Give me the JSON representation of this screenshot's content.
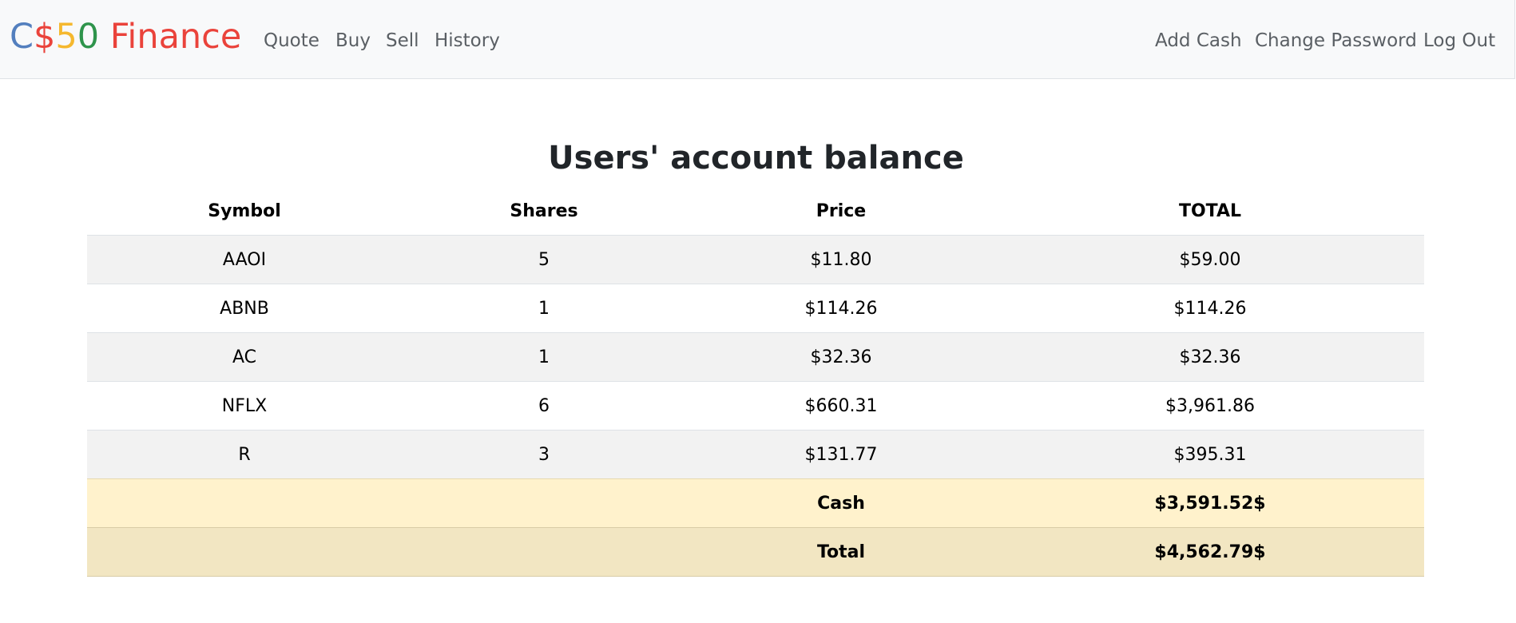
{
  "brand": {
    "parts": [
      {
        "text": "C",
        "color": "#537fbe"
      },
      {
        "text": "$",
        "color": "#ea433b"
      },
      {
        "text": "5",
        "color": "#f5b82e"
      },
      {
        "text": "0",
        "color": "#2e944b"
      },
      {
        "text": " Finance",
        "color": "#ea433b"
      }
    ]
  },
  "nav": {
    "left": [
      "Quote",
      "Buy",
      "Sell",
      "History"
    ],
    "right": [
      "Add Cash",
      "Change Password",
      "Log Out"
    ]
  },
  "main": {
    "title": "Users' account balance",
    "headers": [
      "Symbol",
      "Shares",
      "Price",
      "TOTAL"
    ],
    "rows": [
      {
        "symbol": "AAOI",
        "shares": "5",
        "price": "$11.80",
        "total": "$59.00"
      },
      {
        "symbol": "ABNB",
        "shares": "1",
        "price": "$114.26",
        "total": "$114.26"
      },
      {
        "symbol": "AC",
        "shares": "1",
        "price": "$32.36",
        "total": "$32.36"
      },
      {
        "symbol": "NFLX",
        "shares": "6",
        "price": "$660.31",
        "total": "$3,961.86"
      },
      {
        "symbol": "R",
        "shares": "3",
        "price": "$131.77",
        "total": "$395.31"
      }
    ],
    "cash": {
      "label": "Cash",
      "value": "$3,591.52$"
    },
    "total": {
      "label": "Total",
      "value": "$4,562.79$"
    }
  }
}
